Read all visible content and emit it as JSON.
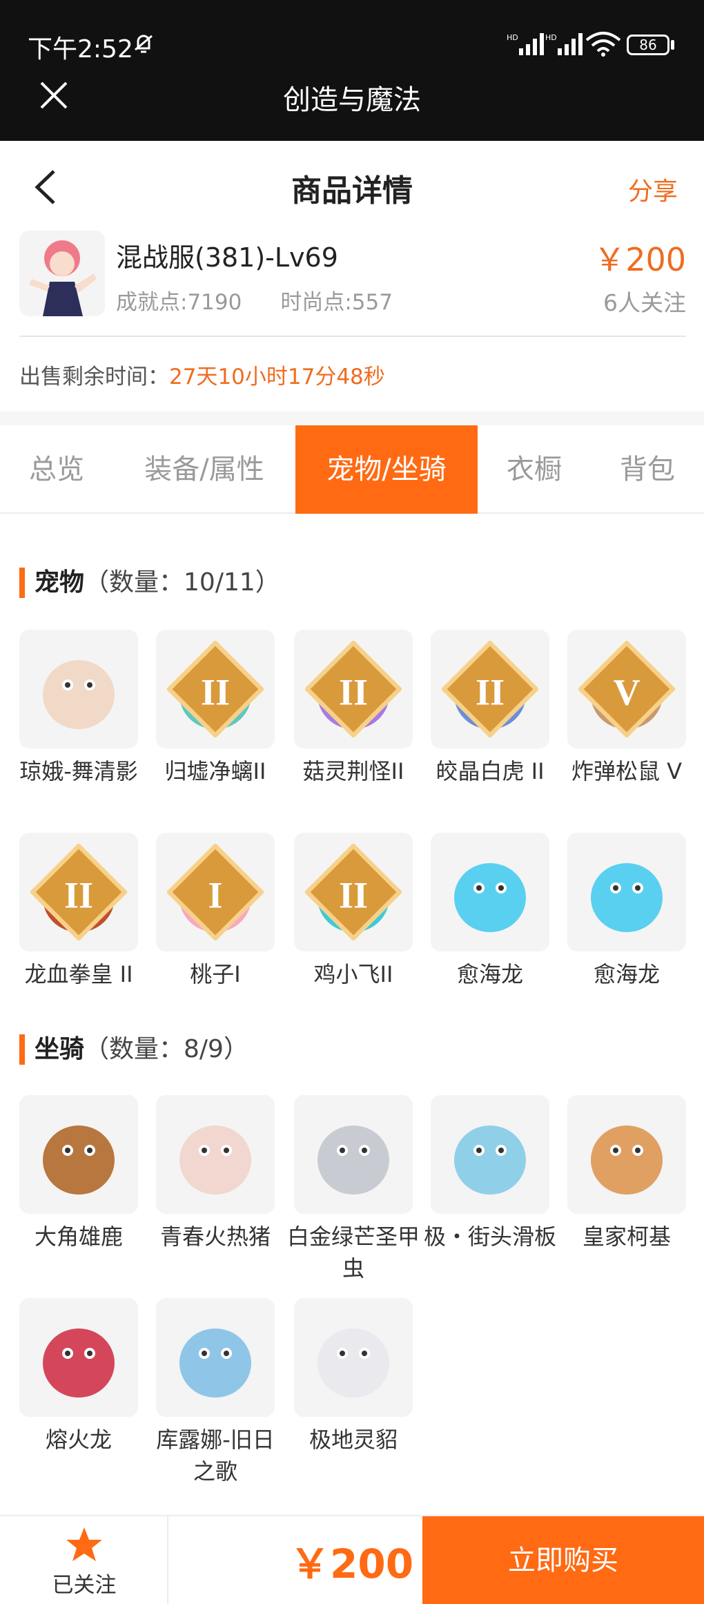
{
  "status_bar": {
    "time": "下午2:52",
    "battery": "86"
  },
  "app": {
    "title": "创造与魔法"
  },
  "header": {
    "title": "商品详情",
    "share": "分享"
  },
  "product": {
    "name": "混战服(381)-Lv69",
    "achievement": "成就点:7190",
    "fashion": "时尚点:557",
    "price": "￥200",
    "followers": "6人关注"
  },
  "remaining": {
    "label": "出售剩余时间：",
    "value": "27天10小时17分48秒"
  },
  "tabs": [
    {
      "label": "总览"
    },
    {
      "label": "装备/属性"
    },
    {
      "label": "宠物/坐骑",
      "active": true
    },
    {
      "label": "衣橱"
    },
    {
      "label": "背包"
    }
  ],
  "pets": {
    "title": "宠物",
    "count": "（数量：10/11）",
    "items": [
      {
        "name": "琼娥-舞清影",
        "icon": "fairy-girl-icon",
        "color": "#f1d9c8"
      },
      {
        "name": "归墟净螭II",
        "icon": "teal-dragon-icon",
        "color": "#5fc7c0",
        "badge": "II"
      },
      {
        "name": "菇灵荆怪II",
        "icon": "purple-mushroom-icon",
        "color": "#a87be0",
        "badge": "II"
      },
      {
        "name": "皎晶白虎 II",
        "icon": "white-tiger-icon",
        "color": "#6b8fd6",
        "badge": "II"
      },
      {
        "name": "炸弹松鼠 V",
        "icon": "squirrel-icon",
        "color": "#c79a6e",
        "badge": "V"
      },
      {
        "name": "龙血拳皇 II",
        "icon": "red-beast-icon",
        "color": "#c0502a",
        "badge": "II"
      },
      {
        "name": "桃子I",
        "icon": "pink-cat-icon",
        "color": "#f7a8c0",
        "badge": "I"
      },
      {
        "name": "鸡小飞II",
        "icon": "blue-bird-icon",
        "color": "#40c9d8",
        "badge": "II"
      },
      {
        "name": "愈海龙",
        "icon": "ice-dragon-icon",
        "color": "#5ad0f0"
      },
      {
        "name": "愈海龙",
        "icon": "ice-dragon-icon",
        "color": "#5ad0f0"
      }
    ]
  },
  "mounts": {
    "title": "坐骑",
    "count": "（数量：8/9）",
    "items": [
      {
        "name": "大角雄鹿",
        "icon": "stag-icon",
        "color": "#b7773f"
      },
      {
        "name": "青春火热猪",
        "icon": "pig-icon",
        "color": "#f2d7d0"
      },
      {
        "name": "白金绿芒圣甲虫",
        "icon": "beetle-icon",
        "color": "#c8ccd2"
      },
      {
        "name": "极・街头滑板",
        "icon": "skateboard-icon",
        "color": "#8fd0e8"
      },
      {
        "name": "皇家柯基",
        "icon": "corgi-icon",
        "color": "#e0a062"
      },
      {
        "name": "熔火龙",
        "icon": "lava-dragon-icon",
        "color": "#d4475b"
      },
      {
        "name": "库露娜-旧日之歌",
        "icon": "sheep-girl-icon",
        "color": "#8fc6e8"
      },
      {
        "name": "极地灵貂",
        "icon": "white-fox-icon",
        "color": "#e9e9ee"
      }
    ]
  },
  "bottom": {
    "follow": "已关注",
    "price": "￥200",
    "buy": "立即购买"
  },
  "colors": {
    "accent": "#ff6a13",
    "price": "#ef6c1f"
  }
}
